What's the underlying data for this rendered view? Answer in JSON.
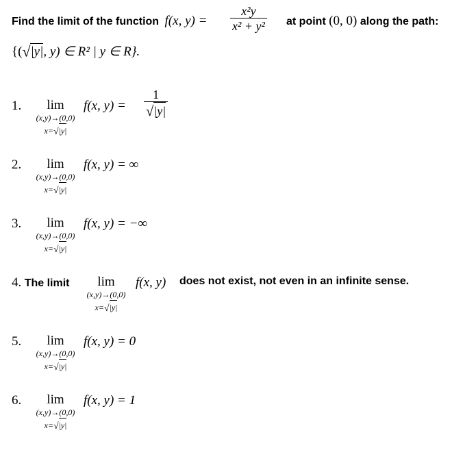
{
  "question": {
    "intro": "Find the limit of the function",
    "func_lhs": "f(x, y) =",
    "fraction_num": "x²y",
    "fraction_den": "x² + y²",
    "at_point_prefix": "at point",
    "point": "(0, 0)",
    "along_path": "along the path:",
    "path_open": "{(",
    "path_sqrt_content": "|y|",
    "path_rest": ", y) ∈ R² | y ∈ R}."
  },
  "limit": {
    "word": "lim",
    "sub": "(x,y)→(0,0)",
    "cond_prefix": "x=",
    "cond_sqrt": "|y|"
  },
  "options": [
    {
      "number": "1.",
      "expr": "f(x, y) =",
      "frac_num": "1",
      "frac_den_sqrt": "|y|"
    },
    {
      "number": "2.",
      "expr": "f(x, y) = ∞"
    },
    {
      "number": "3.",
      "expr": "f(x, y) = −∞"
    },
    {
      "number": "4.",
      "prefix": "The limit",
      "expr": "f(x, y)",
      "suffix": "does not exist, not even in an infinite sense."
    },
    {
      "number": "5.",
      "expr": "f(x, y) = 0"
    },
    {
      "number": "6.",
      "expr": "f(x, y) = 1"
    }
  ]
}
